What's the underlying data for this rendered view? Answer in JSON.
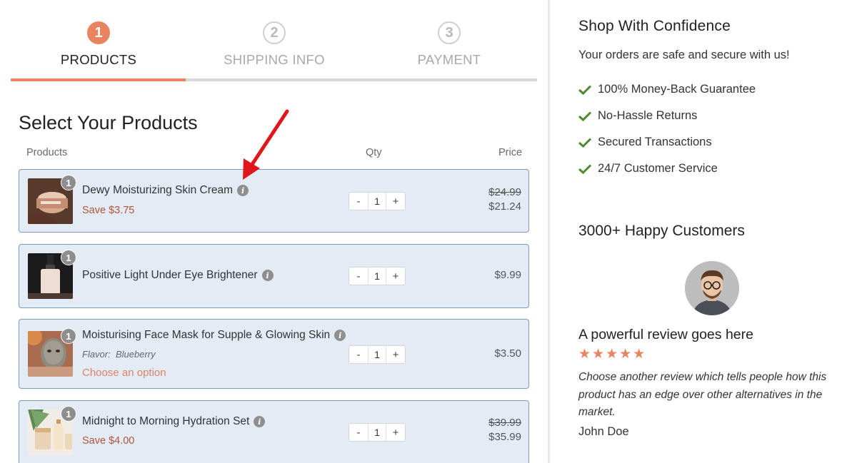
{
  "steps": [
    {
      "number": "1",
      "label": "PRODUCTS",
      "state": "active"
    },
    {
      "number": "2",
      "label": "SHIPPING INFO",
      "state": "inactive"
    },
    {
      "number": "3",
      "label": "PAYMENT",
      "state": "inactive"
    }
  ],
  "progress_fraction": 0.333,
  "main": {
    "title": "Select Your Products",
    "columns": {
      "products": "Products",
      "qty": "Qty",
      "price": "Price"
    }
  },
  "products": [
    {
      "badge": "1",
      "name": "Dewy Moisturizing Skin Cream",
      "save": "Save $3.75",
      "qty": "1",
      "old_price": "$24.99",
      "price": "$21.24"
    },
    {
      "badge": "1",
      "name": "Positive Light Under Eye Brightener",
      "qty": "1",
      "price": "$9.99"
    },
    {
      "badge": "1",
      "name": "Moisturising Face Mask for Supple & Glowing Skin",
      "flavor_label": "Flavor:",
      "flavor_value": "Blueberry",
      "choose": "Choose an option",
      "qty": "1",
      "price": "$3.50"
    },
    {
      "badge": "1",
      "name": "Midnight to Morning Hydration Set",
      "save": "Save $4.00",
      "qty": "1",
      "old_price": "$39.99",
      "price": "$35.99"
    }
  ],
  "qty_controls": {
    "minus": "-",
    "plus": "+"
  },
  "info_icon": "i",
  "sidebar": {
    "title": "Shop With Confidence",
    "subtitle": "Your orders are safe and secure with us!",
    "features": [
      "100% Money-Back Guarantee",
      "No-Hassle Returns",
      "Secured Transactions",
      "24/7 Customer Service"
    ],
    "customers_title": "3000+ Happy Customers",
    "review_title": "A powerful review goes here",
    "stars": "★★★★★",
    "rating": 5,
    "review_text": "Choose another review which tells people how this product has an edge over other alternatives in the market.",
    "reviewer": "John Doe"
  },
  "colors": {
    "accent": "#e8845f",
    "check": "#4e8a2e",
    "card_bg": "#e3ebf5",
    "card_border": "#7d9cbd",
    "arrow": "#e0161b"
  }
}
